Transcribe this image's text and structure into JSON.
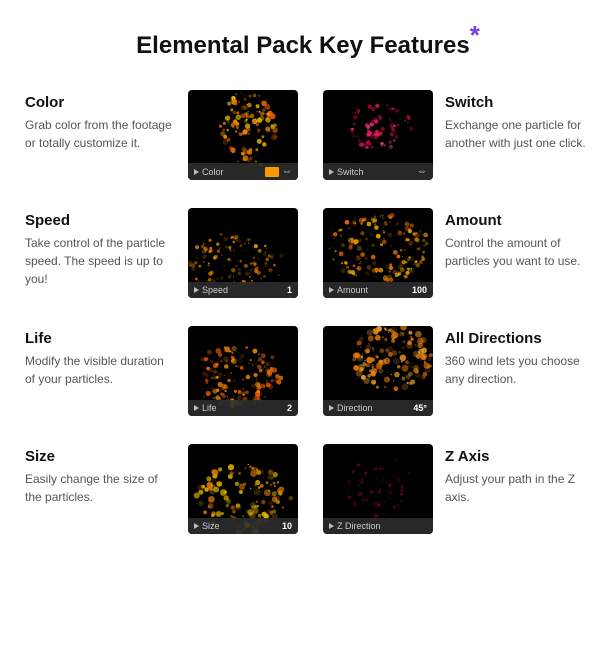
{
  "page": {
    "title": "Elemental Pack Key Features",
    "asterisk": "*"
  },
  "features": [
    {
      "id": "color",
      "title": "Color",
      "desc": "Grab color from the footage or totally customize it.",
      "thumb_label": "Color",
      "thumb_value": "",
      "thumb_has_swatch": true,
      "thumb_has_arrow": true,
      "side": "left",
      "img_type": "color"
    },
    {
      "id": "switch",
      "title": "Switch",
      "desc": "Exchange one particle for another with just one click.",
      "thumb_label": "Switch",
      "thumb_value": "",
      "thumb_has_swatch": false,
      "thumb_has_arrow": true,
      "side": "right",
      "img_type": "switch"
    },
    {
      "id": "speed",
      "title": "Speed",
      "desc": "Take control of the particle speed. The speed is up to you!",
      "thumb_label": "Speed",
      "thumb_value": "1",
      "thumb_has_swatch": false,
      "thumb_has_arrow": false,
      "side": "left",
      "img_type": "speed"
    },
    {
      "id": "amount",
      "title": "Amount",
      "desc": "Control the amount of particles you want to use.",
      "thumb_label": "Amount",
      "thumb_value": "100",
      "thumb_has_swatch": false,
      "thumb_has_arrow": false,
      "side": "right",
      "img_type": "amount"
    },
    {
      "id": "life",
      "title": "Life",
      "desc": "Modify the visible duration of your particles.",
      "thumb_label": "Life",
      "thumb_value": "2",
      "thumb_has_swatch": false,
      "thumb_has_arrow": false,
      "side": "left",
      "img_type": "life"
    },
    {
      "id": "all-directions",
      "title": "All Directions",
      "desc": "360 wind lets you choose any direction.",
      "thumb_label": "Direction",
      "thumb_value": "45°",
      "thumb_has_swatch": false,
      "thumb_has_arrow": false,
      "side": "right",
      "img_type": "direction"
    },
    {
      "id": "size",
      "title": "Size",
      "desc": "Easily change the size of the particles.",
      "thumb_label": "Size",
      "thumb_value": "10",
      "thumb_has_swatch": false,
      "thumb_has_arrow": false,
      "side": "left",
      "img_type": "size"
    },
    {
      "id": "z-axis",
      "title": "Z Axis",
      "desc": "Adjust your path in the Z axis.",
      "thumb_label": "Z Direction",
      "thumb_value": "",
      "thumb_has_swatch": false,
      "thumb_has_arrow": false,
      "side": "right",
      "img_type": "zaxis"
    }
  ]
}
